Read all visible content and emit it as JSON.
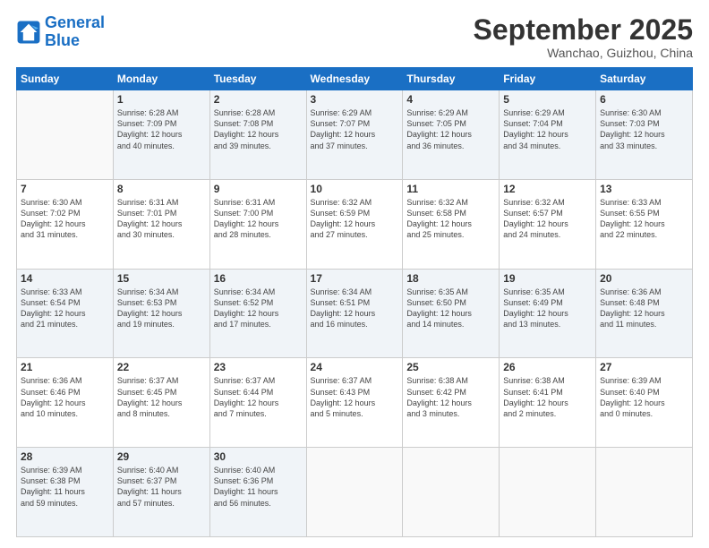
{
  "logo": {
    "line1": "General",
    "line2": "Blue"
  },
  "title": "September 2025",
  "location": "Wanchao, Guizhou, China",
  "weekdays": [
    "Sunday",
    "Monday",
    "Tuesday",
    "Wednesday",
    "Thursday",
    "Friday",
    "Saturday"
  ],
  "weeks": [
    [
      {
        "day": "",
        "info": ""
      },
      {
        "day": "1",
        "info": "Sunrise: 6:28 AM\nSunset: 7:09 PM\nDaylight: 12 hours\nand 40 minutes."
      },
      {
        "day": "2",
        "info": "Sunrise: 6:28 AM\nSunset: 7:08 PM\nDaylight: 12 hours\nand 39 minutes."
      },
      {
        "day": "3",
        "info": "Sunrise: 6:29 AM\nSunset: 7:07 PM\nDaylight: 12 hours\nand 37 minutes."
      },
      {
        "day": "4",
        "info": "Sunrise: 6:29 AM\nSunset: 7:05 PM\nDaylight: 12 hours\nand 36 minutes."
      },
      {
        "day": "5",
        "info": "Sunrise: 6:29 AM\nSunset: 7:04 PM\nDaylight: 12 hours\nand 34 minutes."
      },
      {
        "day": "6",
        "info": "Sunrise: 6:30 AM\nSunset: 7:03 PM\nDaylight: 12 hours\nand 33 minutes."
      }
    ],
    [
      {
        "day": "7",
        "info": "Sunrise: 6:30 AM\nSunset: 7:02 PM\nDaylight: 12 hours\nand 31 minutes."
      },
      {
        "day": "8",
        "info": "Sunrise: 6:31 AM\nSunset: 7:01 PM\nDaylight: 12 hours\nand 30 minutes."
      },
      {
        "day": "9",
        "info": "Sunrise: 6:31 AM\nSunset: 7:00 PM\nDaylight: 12 hours\nand 28 minutes."
      },
      {
        "day": "10",
        "info": "Sunrise: 6:32 AM\nSunset: 6:59 PM\nDaylight: 12 hours\nand 27 minutes."
      },
      {
        "day": "11",
        "info": "Sunrise: 6:32 AM\nSunset: 6:58 PM\nDaylight: 12 hours\nand 25 minutes."
      },
      {
        "day": "12",
        "info": "Sunrise: 6:32 AM\nSunset: 6:57 PM\nDaylight: 12 hours\nand 24 minutes."
      },
      {
        "day": "13",
        "info": "Sunrise: 6:33 AM\nSunset: 6:55 PM\nDaylight: 12 hours\nand 22 minutes."
      }
    ],
    [
      {
        "day": "14",
        "info": "Sunrise: 6:33 AM\nSunset: 6:54 PM\nDaylight: 12 hours\nand 21 minutes."
      },
      {
        "day": "15",
        "info": "Sunrise: 6:34 AM\nSunset: 6:53 PM\nDaylight: 12 hours\nand 19 minutes."
      },
      {
        "day": "16",
        "info": "Sunrise: 6:34 AM\nSunset: 6:52 PM\nDaylight: 12 hours\nand 17 minutes."
      },
      {
        "day": "17",
        "info": "Sunrise: 6:34 AM\nSunset: 6:51 PM\nDaylight: 12 hours\nand 16 minutes."
      },
      {
        "day": "18",
        "info": "Sunrise: 6:35 AM\nSunset: 6:50 PM\nDaylight: 12 hours\nand 14 minutes."
      },
      {
        "day": "19",
        "info": "Sunrise: 6:35 AM\nSunset: 6:49 PM\nDaylight: 12 hours\nand 13 minutes."
      },
      {
        "day": "20",
        "info": "Sunrise: 6:36 AM\nSunset: 6:48 PM\nDaylight: 12 hours\nand 11 minutes."
      }
    ],
    [
      {
        "day": "21",
        "info": "Sunrise: 6:36 AM\nSunset: 6:46 PM\nDaylight: 12 hours\nand 10 minutes."
      },
      {
        "day": "22",
        "info": "Sunrise: 6:37 AM\nSunset: 6:45 PM\nDaylight: 12 hours\nand 8 minutes."
      },
      {
        "day": "23",
        "info": "Sunrise: 6:37 AM\nSunset: 6:44 PM\nDaylight: 12 hours\nand 7 minutes."
      },
      {
        "day": "24",
        "info": "Sunrise: 6:37 AM\nSunset: 6:43 PM\nDaylight: 12 hours\nand 5 minutes."
      },
      {
        "day": "25",
        "info": "Sunrise: 6:38 AM\nSunset: 6:42 PM\nDaylight: 12 hours\nand 3 minutes."
      },
      {
        "day": "26",
        "info": "Sunrise: 6:38 AM\nSunset: 6:41 PM\nDaylight: 12 hours\nand 2 minutes."
      },
      {
        "day": "27",
        "info": "Sunrise: 6:39 AM\nSunset: 6:40 PM\nDaylight: 12 hours\nand 0 minutes."
      }
    ],
    [
      {
        "day": "28",
        "info": "Sunrise: 6:39 AM\nSunset: 6:38 PM\nDaylight: 11 hours\nand 59 minutes."
      },
      {
        "day": "29",
        "info": "Sunrise: 6:40 AM\nSunset: 6:37 PM\nDaylight: 11 hours\nand 57 minutes."
      },
      {
        "day": "30",
        "info": "Sunrise: 6:40 AM\nSunset: 6:36 PM\nDaylight: 11 hours\nand 56 minutes."
      },
      {
        "day": "",
        "info": ""
      },
      {
        "day": "",
        "info": ""
      },
      {
        "day": "",
        "info": ""
      },
      {
        "day": "",
        "info": ""
      }
    ]
  ]
}
